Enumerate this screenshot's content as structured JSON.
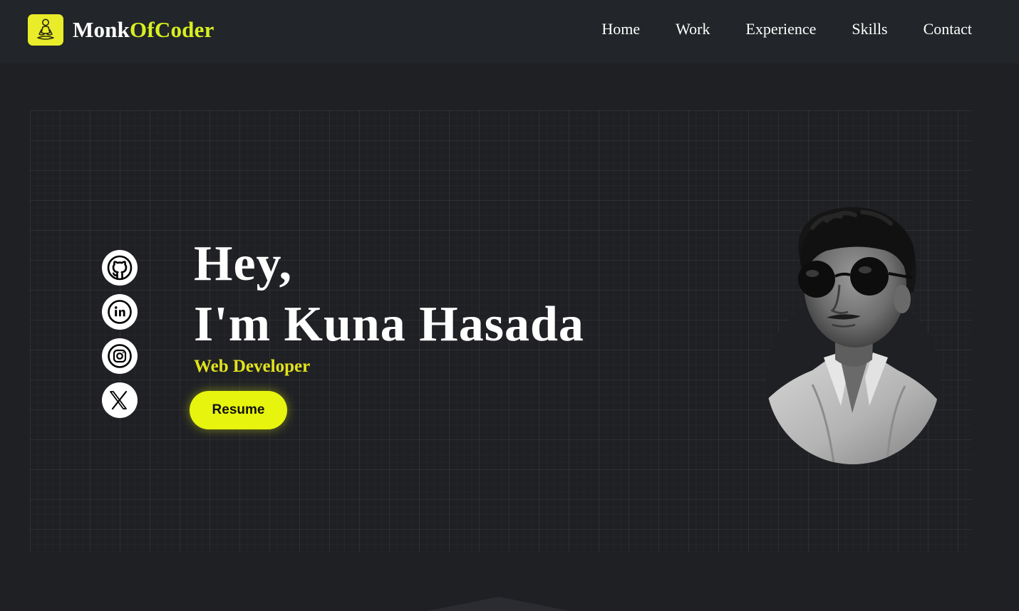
{
  "brand": {
    "part1": "Monk",
    "part2": "OfCoder",
    "accent": "#d8ef20",
    "badge_color": "#e9ec29"
  },
  "nav": {
    "items": [
      "Home",
      "Work",
      "Experience",
      "Skills",
      "Contact"
    ]
  },
  "socials": [
    {
      "name": "github-icon"
    },
    {
      "name": "linkedin-icon"
    },
    {
      "name": "instagram-icon"
    },
    {
      "name": "x-icon"
    }
  ],
  "hero": {
    "greeting": "Hey,",
    "name": "I'm Kuna Hasada",
    "role": "Web Developer",
    "resume_label": "Resume",
    "role_color": "#e2e31d",
    "button_color": "#e7f50e"
  },
  "colors": {
    "background": "#1f2024",
    "navbar": "#222529"
  }
}
